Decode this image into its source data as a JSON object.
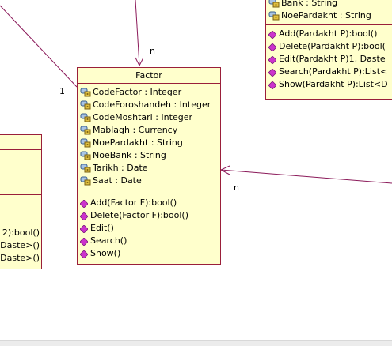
{
  "factor": {
    "name": "Factor",
    "attributes": [
      "CodeFactor : Integer",
      "CodeForoshandeh : Integer",
      "CodeMoshtari : Integer",
      "Mablagh : Currency",
      "NoePardakht : String",
      "NoeBank : String",
      "Tarikh : Date",
      "Saat : Date"
    ],
    "operations": [
      "Add(Factor F):bool()",
      "Delete(Factor F):bool()",
      "Edit()",
      "Search()",
      "Show()"
    ]
  },
  "pardakht": {
    "attributes": [
      "Bank : String",
      "NoePardakht : String"
    ],
    "operations": [
      "Add(Pardakht P):bool()",
      "Delete(Pardakht P):bool(",
      "Edit(Pardakht P)1, Daste",
      "Search(Pardakht P):List<",
      "Show(Pardakht P):List<D"
    ]
  },
  "left_class": {
    "operations": [
      "2):bool()",
      "Daste>()",
      "Daste>()"
    ]
  },
  "multiplicities": {
    "top": "n",
    "left": "1",
    "right": "n"
  },
  "colors": {
    "box_fill": "#ffffcc",
    "box_border": "#9a1f3a",
    "association_line": "#8b1a5a",
    "operation_icon": "#cc33cc"
  }
}
